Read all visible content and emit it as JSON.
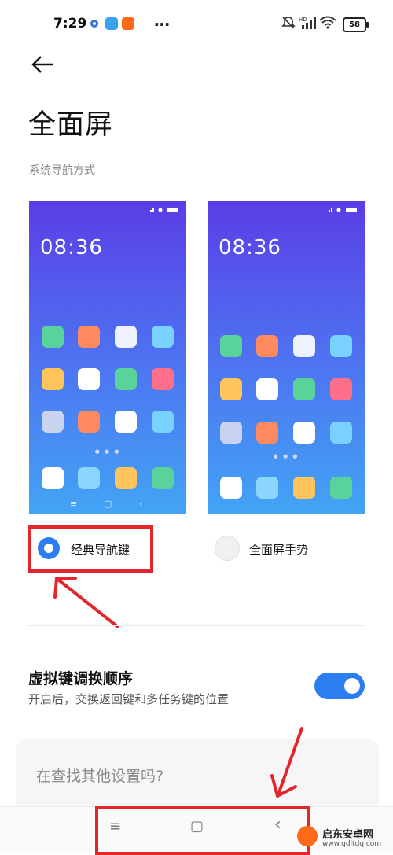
{
  "status_bar": {
    "time": "7:29",
    "more": "…",
    "battery": "58"
  },
  "header": {
    "title": "全面屏",
    "section": "系统导航方式"
  },
  "previews": [
    {
      "time": "08:36",
      "nav_buttons": [
        "≡",
        "▢",
        "‹"
      ]
    },
    {
      "time": "08:36"
    }
  ],
  "options": [
    {
      "label": "经典导航键",
      "selected": true
    },
    {
      "label": "全面屏手势",
      "selected": false
    }
  ],
  "swap_setting": {
    "title": "虚拟键调换顺序",
    "description": "开启后，交换返回键和多任务键的位置",
    "enabled": true
  },
  "search_card": {
    "text": "在查找其他设置吗?"
  },
  "navbar": {
    "menu": "≡",
    "home": "▢",
    "back": "‹"
  },
  "watermark": {
    "title": "启东安卓网",
    "url": "www.qdltdq.com"
  },
  "colors": {
    "accent": "#2c7df2",
    "annotation": "#e2262b"
  },
  "icons": [
    "back-arrow-icon",
    "mute-icon",
    "signal-icon",
    "wifi-icon",
    "battery-icon"
  ]
}
